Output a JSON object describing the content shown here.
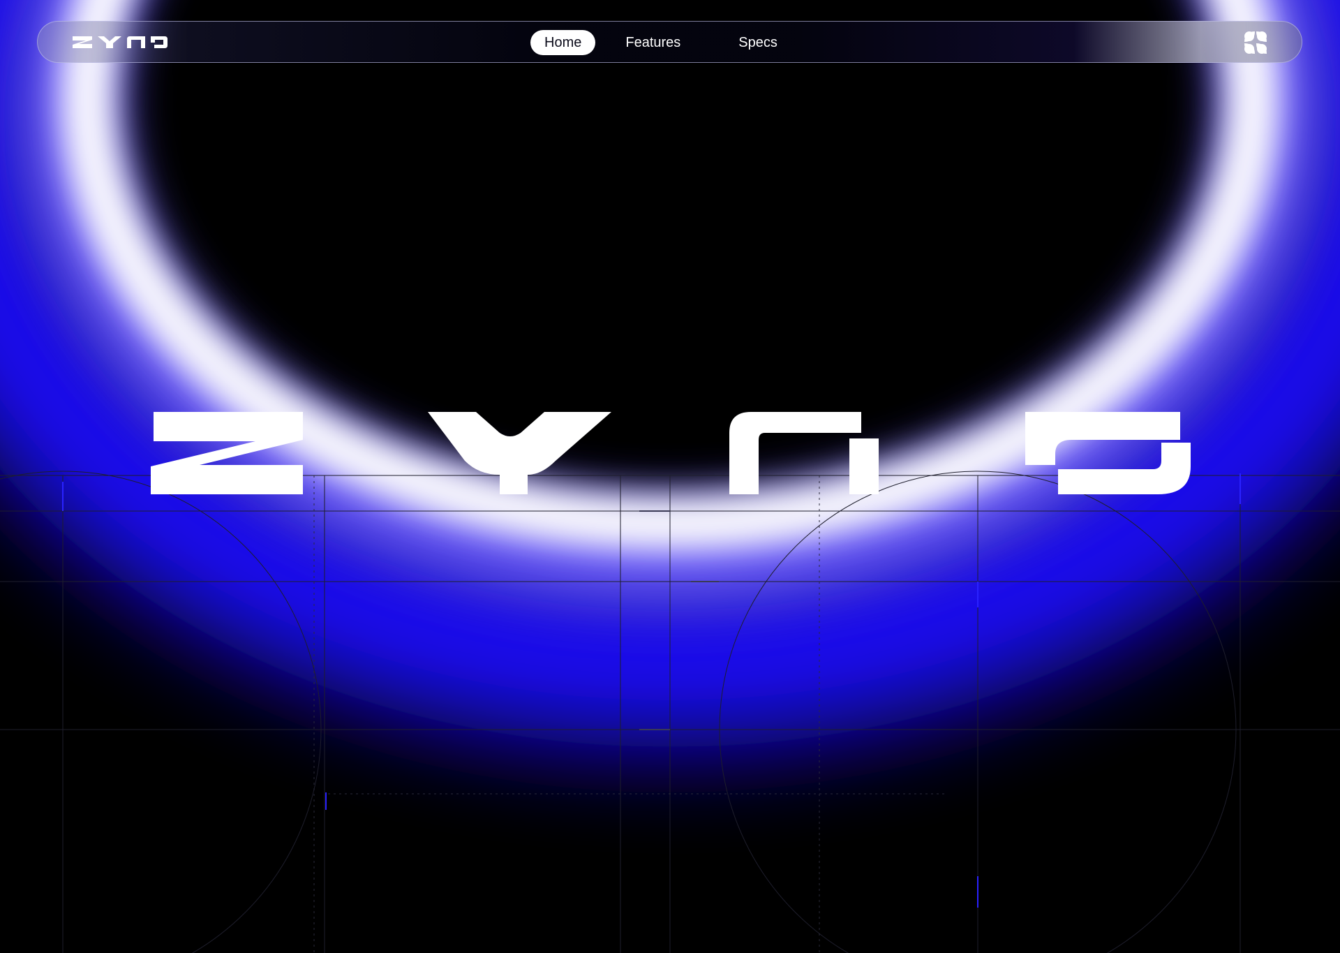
{
  "brand": {
    "name": "zyno",
    "logo_icon": "zyno-wordmark-logo"
  },
  "nav": {
    "items": [
      {
        "label": "Home",
        "active": true
      },
      {
        "label": "Features",
        "active": false
      },
      {
        "label": "Specs",
        "active": false
      }
    ],
    "menu_icon": "four-petal-menu-icon"
  },
  "hero": {
    "wordmark": "zyno"
  },
  "colors": {
    "background": "#000000",
    "glow_core": "#ffffff",
    "glow_inner": "#7b6dff",
    "glow_outer": "#1a10ff",
    "grid_line": "#1c1c2a",
    "accent_tick": "#2a22ff"
  }
}
